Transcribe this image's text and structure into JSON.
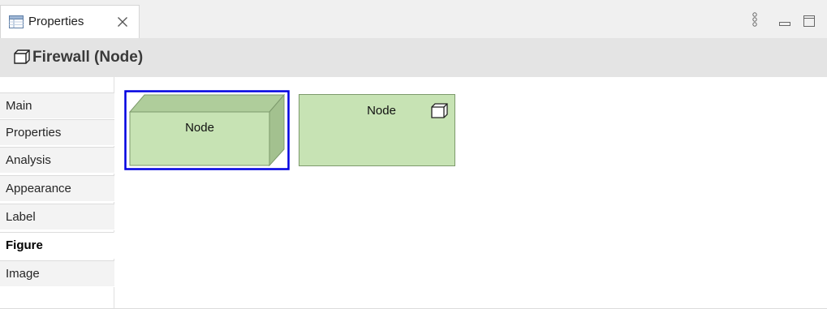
{
  "tab": {
    "label": "Properties",
    "icon": "table-icon"
  },
  "toolbar": {
    "menu_icon": "view-menu-icon",
    "minimize_icon": "minimize-icon",
    "maximize_icon": "maximize-icon"
  },
  "header": {
    "title": "Firewall (Node)",
    "icon": "cube-icon"
  },
  "sidebar": {
    "items": [
      {
        "label": "Main"
      },
      {
        "label": "Properties"
      },
      {
        "label": "Analysis"
      },
      {
        "label": "Appearance"
      },
      {
        "label": "Label"
      },
      {
        "label": "Figure",
        "active": true
      },
      {
        "label": "Image"
      }
    ]
  },
  "figures": [
    {
      "label": "Node",
      "style": "3d-box",
      "selected": true
    },
    {
      "label": "Node",
      "style": "rectangle-with-icon",
      "selected": false
    }
  ],
  "colors": {
    "node_fill": "#c7e3b4",
    "node_fill_dark": "#a8c795",
    "node_border": "#7d9a6c",
    "selection": "#0000e0"
  }
}
